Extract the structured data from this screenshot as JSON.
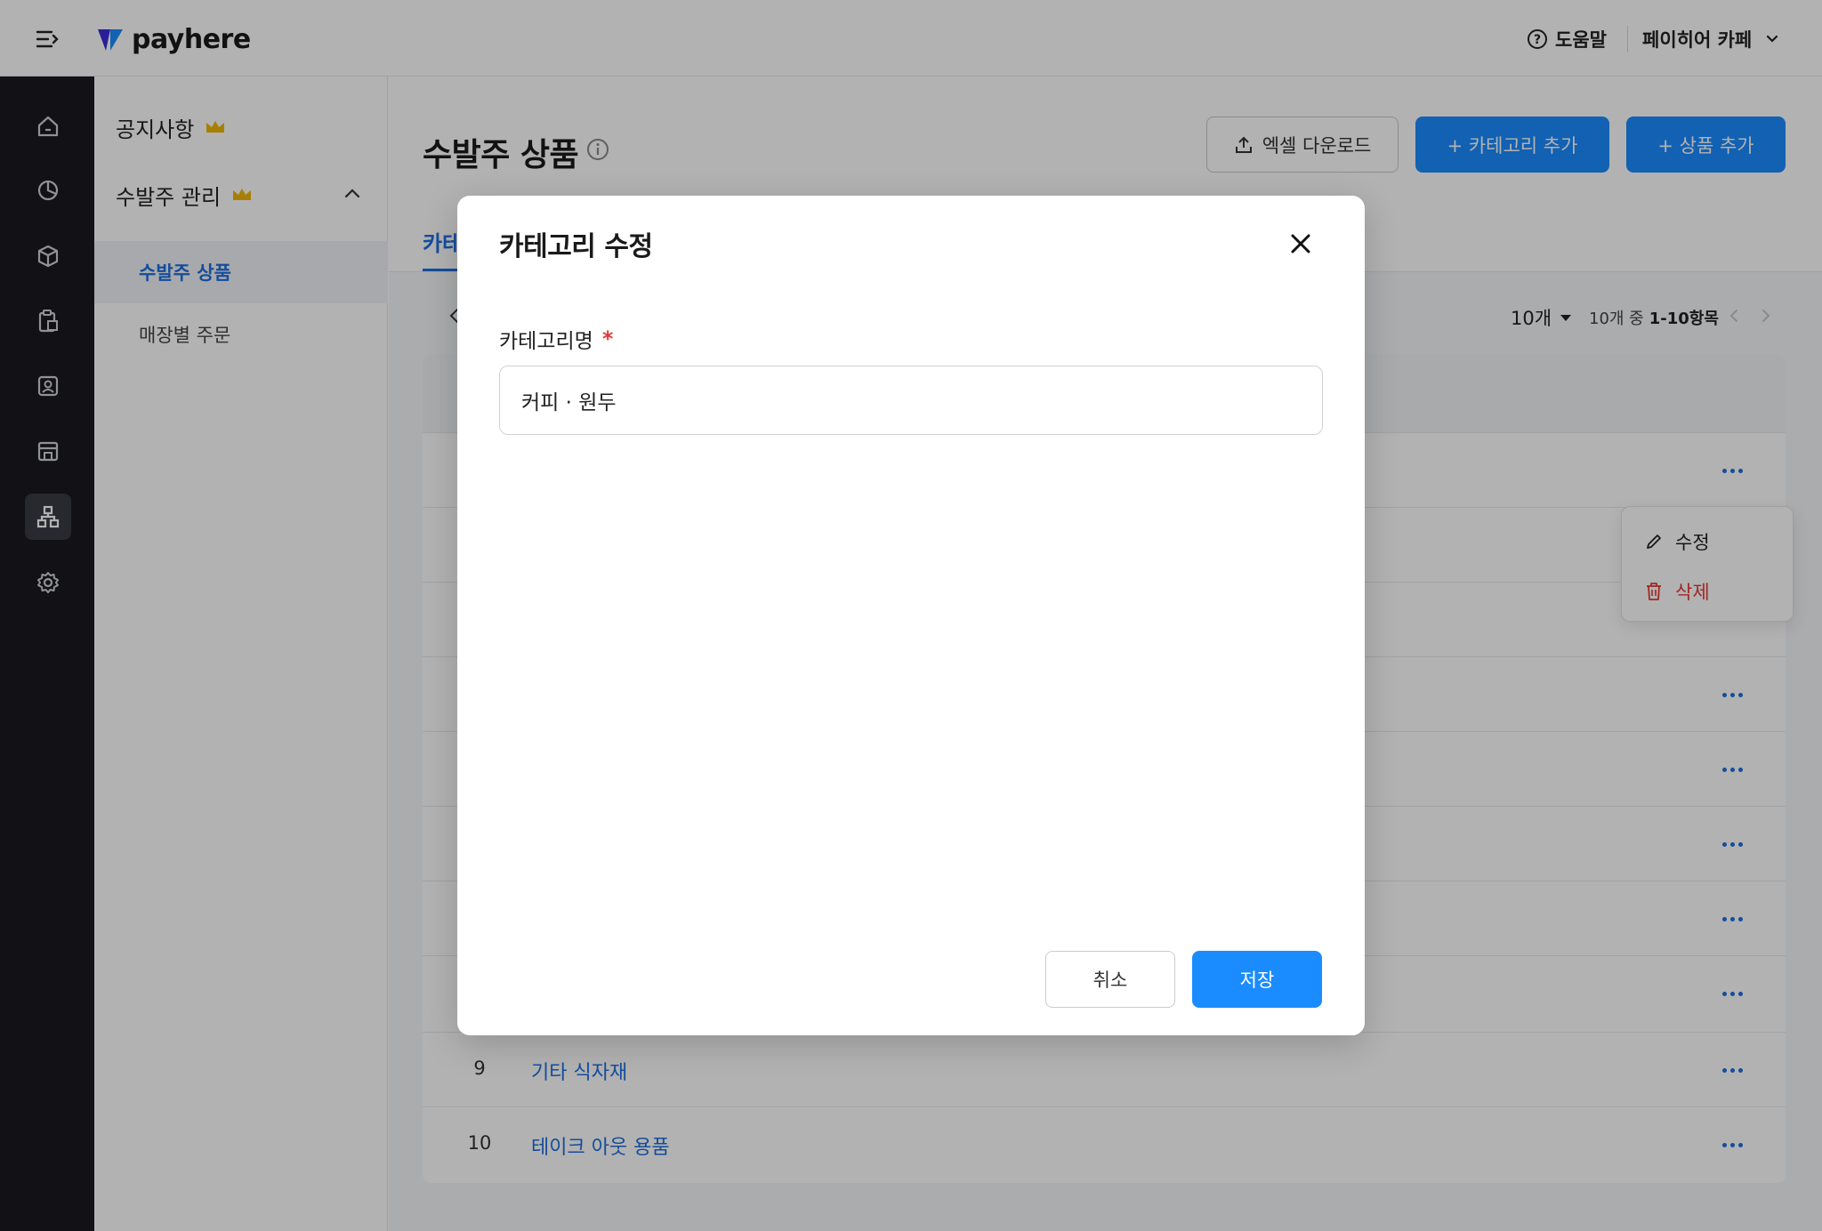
{
  "header": {
    "brand": "payhere",
    "help_label": "도움말",
    "store_name": "페이히어 카페"
  },
  "rail": {
    "items": [
      "home-icon",
      "chart-icon",
      "box-icon",
      "clipboard-icon",
      "contact-icon",
      "store-icon",
      "hierarchy-icon",
      "settings-icon"
    ],
    "active": "hierarchy-icon"
  },
  "subnav": {
    "notice": "공지사항",
    "order_mgmt": "수발주 관리",
    "items": [
      {
        "label": "수발주 상품",
        "active": true
      },
      {
        "label": "매장별 주문",
        "active": false
      }
    ]
  },
  "main": {
    "title": "수발주 상품",
    "buttons": {
      "excel": "엑셀 다운로드",
      "add_category": "+ 카테고리 추가",
      "add_product": "+ 상품 추가"
    },
    "tab_visible_label": "카테",
    "pager": {
      "page_size": "10개",
      "range_prefix": "10개 중",
      "range_value": "1-10항목"
    },
    "rows": [
      {
        "no": "9",
        "name": "기타 식자재"
      },
      {
        "no": "10",
        "name": "테이크 아웃 용품"
      }
    ],
    "row_menu": {
      "edit": "수정",
      "delete": "삭제"
    }
  },
  "modal": {
    "title": "카테고리 수정",
    "field_label": "카테고리명",
    "required_mark": "*",
    "field_value": "커피 · 원두",
    "cancel": "취소",
    "save": "저장"
  },
  "colors": {
    "primary": "#1a8cff",
    "link": "#1d6fe0",
    "danger": "#e53935",
    "rail": "#1a1b20",
    "crown": "#f2b705"
  }
}
